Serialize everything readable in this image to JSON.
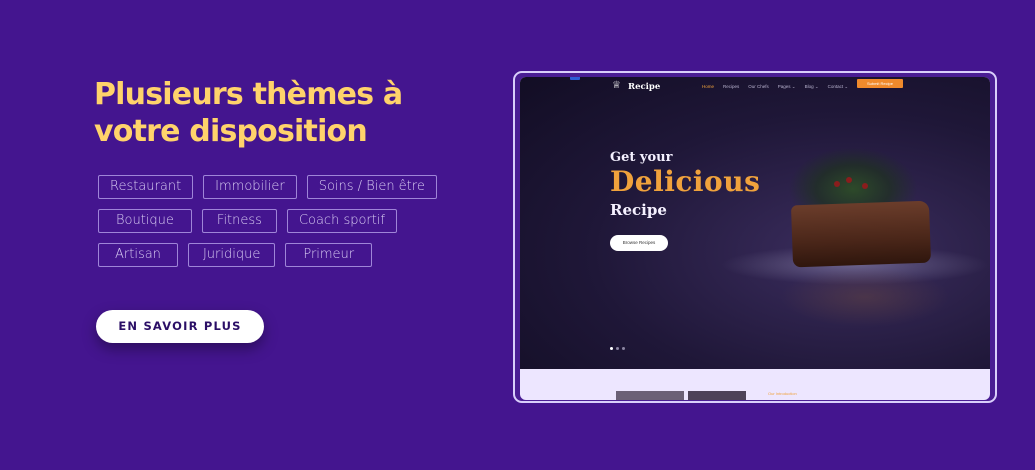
{
  "headline": {
    "line1": "Plusieurs thèmes à",
    "line2": "votre disposition"
  },
  "tags": {
    "row1": [
      "Restaurant",
      "Immobilier",
      "Soins / Bien être"
    ],
    "row2": [
      "Boutique",
      "Fitness",
      "Coach sportif"
    ],
    "row3": [
      "Artisan",
      "Juridique",
      "Primeur"
    ]
  },
  "cta": {
    "label": "EN SAVOIR PLUS"
  },
  "preview": {
    "logo": "Recipe",
    "logo_icon": "chef-hat-icon",
    "nav": [
      "Home",
      "Recipes",
      "Our Chefs",
      "Pages ⌄",
      "Blog ⌄",
      "Contact ⌄"
    ],
    "nav_button": "Submit Recipe",
    "hero_line1": "Get your",
    "hero_line2": "Delicious",
    "hero_line3": "Recipe",
    "hero_button": "Browse Recipes",
    "lower_label": "Our Introduction"
  },
  "colors": {
    "background": "#44158f",
    "headline": "#ffd36b",
    "accent": "#f0a23c"
  }
}
